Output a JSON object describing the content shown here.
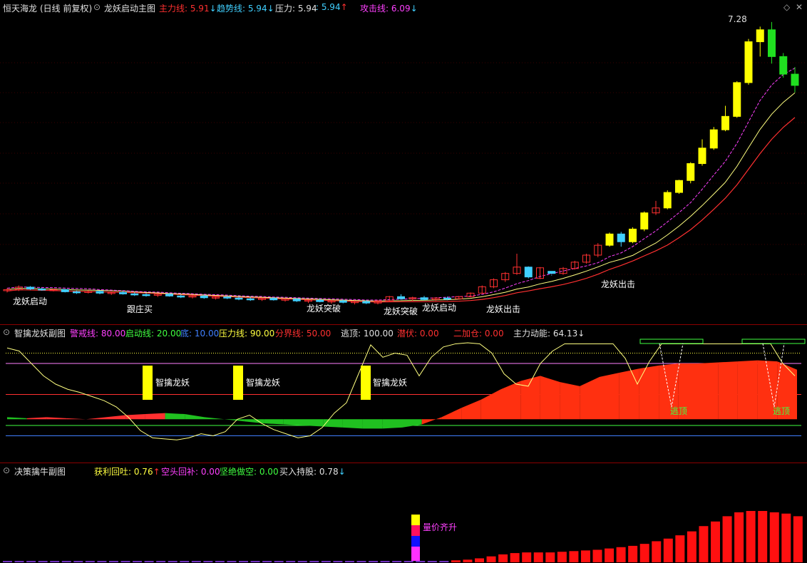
{
  "main": {
    "stock": "恒天海龙",
    "period": "(日线 前复权)",
    "indicator": "龙妖启动主图",
    "fields": [
      {
        "label": "主力线: 5.91",
        "arrow": "↓",
        "color": "#ff3030"
      },
      {
        "label": "趋势线: 5.94",
        "arrow": "↓",
        "color": "#40d0ff"
      },
      {
        "label": "压力: 5.94",
        "arrow": "",
        "color": "#e0e0e0"
      },
      {
        "label": ": 5.94",
        "arrow": "↑",
        "color": "#40d0ff"
      },
      {
        "label": "攻击线: 6.09",
        "arrow": "↓",
        "color": "#ff40ff"
      }
    ],
    "peak_label": "7.28",
    "signals": {
      "start": "龙妖启动",
      "follow": "跟庄买",
      "breakout": "龙妖突破",
      "attack": "龙妖出击"
    }
  },
  "sub1": {
    "title": "智擒龙妖副图",
    "fields": [
      {
        "label": "警戒线: 80.00",
        "color": "#ff40ff"
      },
      {
        "label": "启动线: 20.00",
        "color": "#40ff40"
      },
      {
        "label": "底: 10.00",
        "color": "#4080ff"
      },
      {
        "label": "压力线: 90.00",
        "color": "#ffff40"
      },
      {
        "label": "分界线: 50.00",
        "color": "#ff3030"
      },
      {
        "label": "逃顶: 100.00",
        "color": "#e0e0e0"
      },
      {
        "label": "潜伏: 0.00",
        "color": "#ff3030"
      },
      {
        "label": "二加仓: 0.00",
        "color": "#ff3030"
      },
      {
        "label": "主力动能: 64.13↓",
        "color": "#e0e0e0"
      }
    ],
    "tag": "智擒龙妖",
    "escape": "逃顶"
  },
  "sub2": {
    "title": "决策擒牛副图",
    "fields": [
      {
        "label": "获利回吐: 0.76",
        "arrow": "↑",
        "color": "#ffff40"
      },
      {
        "label": "空头回补: 0.00",
        "arrow": "",
        "color": "#ff40ff"
      },
      {
        "label": "坚绝做空: 0.00",
        "arrow": "",
        "color": "#40ff40"
      },
      {
        "label": "买入持股: 0.78",
        "arrow": "↓",
        "color": "#e0e0e0"
      }
    ],
    "signal": "量价齐升"
  },
  "chart_data": [
    {
      "type": "candlestick",
      "title": "龙妖启动主图",
      "candles": [
        [
          5.95,
          6.02,
          5.9,
          5.98
        ],
        [
          5.98,
          6.1,
          5.94,
          6.05
        ],
        [
          6.05,
          6.08,
          5.97,
          6.0
        ],
        [
          6.0,
          6.03,
          5.95,
          5.97
        ],
        [
          5.97,
          6.01,
          5.93,
          5.98
        ],
        [
          5.98,
          6.0,
          5.9,
          5.92
        ],
        [
          5.92,
          5.95,
          5.86,
          5.9
        ],
        [
          5.9,
          5.96,
          5.87,
          5.93
        ],
        [
          5.93,
          5.95,
          5.85,
          5.88
        ],
        [
          5.88,
          5.92,
          5.83,
          5.9
        ],
        [
          5.9,
          5.93,
          5.84,
          5.86
        ],
        [
          5.86,
          5.9,
          5.8,
          5.84
        ],
        [
          5.84,
          5.88,
          5.78,
          5.82
        ],
        [
          5.82,
          5.87,
          5.77,
          5.85
        ],
        [
          5.85,
          5.88,
          5.78,
          5.8
        ],
        [
          5.8,
          5.84,
          5.74,
          5.78
        ],
        [
          5.78,
          5.82,
          5.73,
          5.8
        ],
        [
          5.8,
          5.83,
          5.72,
          5.75
        ],
        [
          5.75,
          5.79,
          5.7,
          5.77
        ],
        [
          5.77,
          5.8,
          5.71,
          5.74
        ],
        [
          5.74,
          5.78,
          5.68,
          5.72
        ],
        [
          5.72,
          5.76,
          5.66,
          5.7
        ],
        [
          5.7,
          5.75,
          5.66,
          5.73
        ],
        [
          5.73,
          5.76,
          5.67,
          5.69
        ],
        [
          5.69,
          5.73,
          5.64,
          5.71
        ],
        [
          5.71,
          5.74,
          5.63,
          5.66
        ],
        [
          5.66,
          5.7,
          5.6,
          5.68
        ],
        [
          5.68,
          5.72,
          5.62,
          5.64
        ],
        [
          5.64,
          5.69,
          5.58,
          5.66
        ],
        [
          5.66,
          5.7,
          5.59,
          5.62
        ],
        [
          5.62,
          5.67,
          5.56,
          5.64
        ],
        [
          5.64,
          5.68,
          5.57,
          5.6
        ],
        [
          5.6,
          5.68,
          5.56,
          5.66
        ],
        [
          5.66,
          5.8,
          5.64,
          5.78
        ],
        [
          5.78,
          5.85,
          5.7,
          5.72
        ],
        [
          5.72,
          5.78,
          5.66,
          5.75
        ],
        [
          5.75,
          5.8,
          5.68,
          5.7
        ],
        [
          5.7,
          5.76,
          5.66,
          5.74
        ],
        [
          5.74,
          5.78,
          5.68,
          5.72
        ],
        [
          5.72,
          5.8,
          5.7,
          5.78
        ],
        [
          5.78,
          5.9,
          5.76,
          5.88
        ],
        [
          5.88,
          6.1,
          5.86,
          6.06
        ],
        [
          6.06,
          6.3,
          6.02,
          6.26
        ],
        [
          6.26,
          6.48,
          6.2,
          6.44
        ],
        [
          6.44,
          7.0,
          6.4,
          6.62
        ],
        [
          6.62,
          6.64,
          6.3,
          6.34
        ],
        [
          6.3,
          6.62,
          6.28,
          6.6
        ],
        [
          6.5,
          6.4,
          6.38,
          6.44
        ],
        [
          6.44,
          6.62,
          6.4,
          6.58
        ],
        [
          6.58,
          6.8,
          6.55,
          6.76
        ],
        [
          6.76,
          7.0,
          6.72,
          6.96
        ],
        [
          6.96,
          7.3,
          6.9,
          7.24
        ],
        [
          7.24,
          7.6,
          7.2,
          7.56
        ],
        [
          7.56,
          7.62,
          7.2,
          7.34
        ],
        [
          7.34,
          7.75,
          7.3,
          7.7
        ],
        [
          7.7,
          8.2,
          7.64,
          8.16
        ],
        [
          8.16,
          8.5,
          8.1,
          8.3
        ],
        [
          8.3,
          8.8,
          8.26,
          8.74
        ],
        [
          8.74,
          9.1,
          8.7,
          9.08
        ],
        [
          9.08,
          9.6,
          9.0,
          9.56
        ],
        [
          9.56,
          10.25,
          9.5,
          10.0
        ],
        [
          10.0,
          10.6,
          9.95,
          10.52
        ],
        [
          10.52,
          11.2,
          10.48,
          10.9
        ],
        [
          10.9,
          11.9,
          10.86,
          11.86
        ],
        [
          11.86,
          13.1,
          11.8,
          13.02
        ],
        [
          13.02,
          13.45,
          12.6,
          13.36
        ],
        [
          13.36,
          13.58,
          12.4,
          12.6
        ],
        [
          12.6,
          12.7,
          12.0,
          12.1
        ],
        [
          12.1,
          12.3,
          11.58,
          11.78
        ]
      ],
      "lines": {
        "趋势线": "cyan",
        "主力线": "red",
        "攻击线": "magenta",
        "压力": "white"
      }
    },
    {
      "type": "area",
      "title": "智擒龙妖副图",
      "levels": {
        "警戒线": 80,
        "启动线": 20,
        "底": 10,
        "压力线": 90,
        "分界线": 50
      },
      "ylim": [
        0,
        100
      ]
    },
    {
      "type": "bar",
      "title": "决策擒牛副图",
      "values": [
        0.02,
        0.02,
        0.02,
        0.02,
        0.02,
        0.02,
        0.02,
        0.02,
        0.02,
        0.02,
        0.02,
        0.02,
        0.02,
        0.02,
        0.02,
        0.02,
        0.02,
        0.02,
        0.02,
        0.02,
        0.02,
        0.02,
        0.02,
        0.02,
        0.02,
        0.02,
        0.02,
        0.02,
        0.02,
        0.02,
        0.02,
        0.02,
        0.02,
        0.02,
        0.02,
        0.02,
        0.02,
        0.02,
        0.03,
        0.04,
        0.06,
        0.09,
        0.12,
        0.14,
        0.15,
        0.15,
        0.15,
        0.16,
        0.17,
        0.18,
        0.19,
        0.21,
        0.23,
        0.25,
        0.28,
        0.32,
        0.36,
        0.41,
        0.47,
        0.55,
        0.62,
        0.7,
        0.76,
        0.78,
        0.78,
        0.76,
        0.74,
        0.7
      ]
    }
  ]
}
